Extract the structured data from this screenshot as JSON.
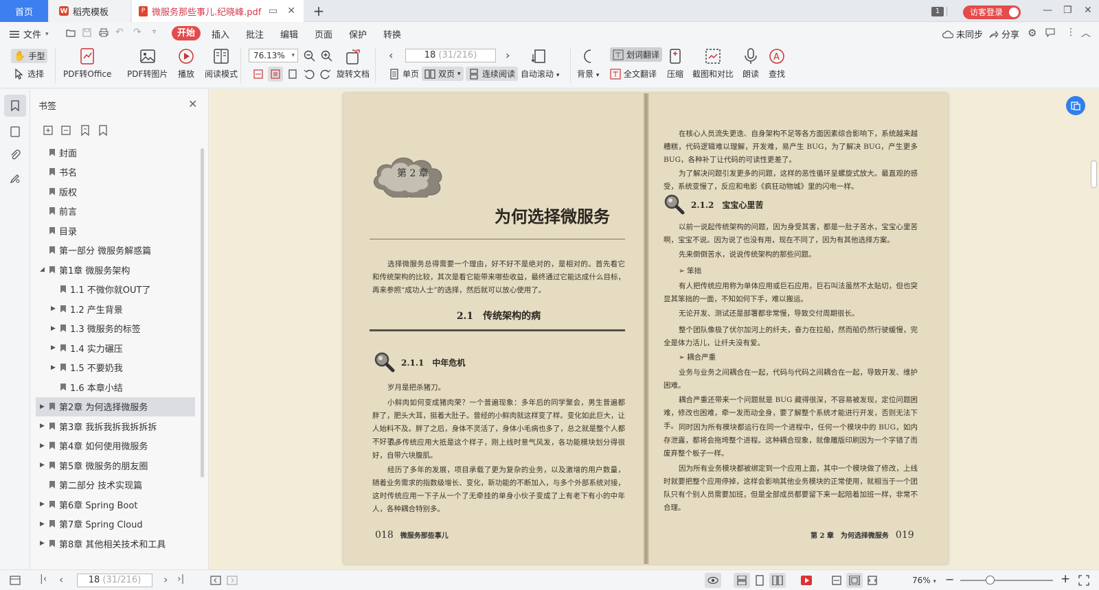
{
  "tabs": {
    "home": "首页",
    "templates": "稻壳模板",
    "document": "微服务那些事儿.纪晓峰.pdf",
    "add": "+"
  },
  "titlebar": {
    "badge": "1",
    "visitor_login": "访客登录",
    "minimize": "—",
    "maximize": "❐",
    "close": "✕"
  },
  "menu": {
    "file": "文件",
    "items": [
      "开始",
      "插入",
      "批注",
      "编辑",
      "页面",
      "保护",
      "转换"
    ],
    "unsynced": "未同步",
    "share": "分享"
  },
  "ribbon": {
    "hand": "手型",
    "select": "选择",
    "pdf_to_office": "PDF转Office",
    "pdf_to_image": "PDF转图片",
    "play": "播放",
    "read_mode": "阅读模式",
    "zoom_value": "76.13%",
    "rotate": "旋转文档",
    "page_current": "18",
    "page_total": "(31/216)",
    "single_page": "单页",
    "double_page": "双页",
    "continuous": "连续阅读",
    "auto_scroll": "自动滚动",
    "background": "背景",
    "word_translate": "划词翻译",
    "full_translate": "全文翻译",
    "compress": "压缩",
    "screenshot_compare": "截图和对比",
    "read_aloud": "朗读",
    "find": "查找"
  },
  "bookmarks": {
    "title": "书签",
    "items": [
      {
        "label": "封面",
        "level": 0,
        "arrow": ""
      },
      {
        "label": "书名",
        "level": 0,
        "arrow": ""
      },
      {
        "label": "版权",
        "level": 0,
        "arrow": ""
      },
      {
        "label": "前言",
        "level": 0,
        "arrow": ""
      },
      {
        "label": "目录",
        "level": 0,
        "arrow": ""
      },
      {
        "label": "第一部分 微服务解惑篇",
        "level": 0,
        "arrow": ""
      },
      {
        "label": "第1章 微服务架构",
        "level": 0,
        "arrow": "down"
      },
      {
        "label": "1.1 不微你就OUT了",
        "level": 1,
        "arrow": ""
      },
      {
        "label": "1.2 产生背景",
        "level": 1,
        "arrow": "right"
      },
      {
        "label": "1.3 微服务的标签",
        "level": 1,
        "arrow": "right"
      },
      {
        "label": "1.4 实力碾压",
        "level": 1,
        "arrow": "right"
      },
      {
        "label": "1.5 不要奶我",
        "level": 1,
        "arrow": "right"
      },
      {
        "label": "1.6 本章小结",
        "level": 1,
        "arrow": ""
      },
      {
        "label": "第2章 为何选择微服务",
        "level": 0,
        "arrow": "right",
        "selected": true
      },
      {
        "label": "第3章 我拆我拆我拆拆拆",
        "level": 0,
        "arrow": "right"
      },
      {
        "label": "第4章 如何使用微服务",
        "level": 0,
        "arrow": "right"
      },
      {
        "label": "第5章 微服务的朋友圈",
        "level": 0,
        "arrow": "right"
      },
      {
        "label": "第二部分 技术实现篇",
        "level": 0,
        "arrow": ""
      },
      {
        "label": "第6章 Spring Boot",
        "level": 0,
        "arrow": "right"
      },
      {
        "label": "第7章 Spring Cloud",
        "level": 0,
        "arrow": "right"
      },
      {
        "label": "第8章 其他相关技术和工具",
        "level": 0,
        "arrow": "right"
      }
    ]
  },
  "left_page": {
    "chapter_badge": "第 2 章",
    "chapter_title": "为何选择微服务",
    "intro": "选择微服务总得需要一个理由，好不好不是绝对的，是相对的。首先看它和传统架构的比较，其次是看它能带来哪些收益，最终通过它能达成什么目标，再来参照“成功人士”的选择，然后就可以放心使用了。",
    "section": "2.1　传统架构的病",
    "subsection": "2.1.1　中年危机",
    "paragraphs": [
      "岁月是把杀猪刀。",
      "小鲜肉如何变成猪肉荣？一个普遍现象：多年后的同学聚会，男生普遍都胖了，肥头大耳，挺着大肚子。曾经的小鲜肉就这样变了样。变化如此巨大，让人始料不及。胖了之后，身体不灵活了，身体小毛病也多了，总之就是整个人都不好了。",
      "很多传统应用大抵是这个样子，刚上线时意气风发，各功能模块划分得很好，自带六块腹肌。",
      "经历了多年的发展，项目承载了更为复杂的业务，以及激增的用户数量，随着业务需求的指数级增长、变化，新功能的不断加入，与多个外部系统对接，这时传统应用一下子从一个了无牵挂的单身小伙子变成了上有老下有小的中年人，各种耦合特别多。"
    ],
    "footer_num": "018",
    "footer_title": "微服务那些事儿"
  },
  "right_page": {
    "p1": "在核心人员流失更迭、自身架构不足等各方面因素综合影响下，系统越来越糟糕，代码逻辑难以理解，开发难，易产生 BUG，为了解决 BUG，产生更多 BUG，各种补丁让代码的可读性更差了。",
    "p2": "为了解决问题引发更多的问题，这样的恶性循环呈螺旋式放大。最直观的感受，系统变慢了，反应和电影《疯狂动物城》里的闪电一样。",
    "subsection": "2.1.2　宝宝心里苦",
    "p3": "以前一说起传统架构的问题，因为身受其害，都是一肚子苦水，宝宝心里苦啊，宝宝不说。因为说了也没有用，现在不同了，因为有其他选择方案。",
    "p4": "先来倒倒苦水，说说传统架构的那些问题。",
    "b1": "➢ 笨拙",
    "p5": "有人把传统应用称为单体应用或巨石应用，巨石叫法虽然不太贴切，但也突显其笨拙的一面，不知如何下手，难以搬运。",
    "p6": "无论开发、测试还是部署都非常慢，导致交付周期很长。",
    "p7": "整个团队像极了伏尔加河上的纤夫，奋力在拉船，然而船仍然行驶缓慢，完全是体力活儿，让纤夫没有爱。",
    "b2": "➢ 耦合严重",
    "p8": "业务与业务之间耦合在一起，代码与代码之间耦合在一起，导致开发、维护困难。",
    "p9": "耦合严重还带来一个问题就是 BUG 藏得很深，不容易被发现，定位问题困难，修改也困难，牵一发而动全身，要了解整个系统才能进行开发，否则无法下手。",
    "p10": "同时因为所有模块都运行在同一个进程中，任何一个模块中的 BUG，如内存泄露，都将会拖垮整个进程。这种耦合现象，就像雕版印刷因为一个字错了而废弃整个板子一样。",
    "p11": "因为所有业务模块都被绑定到一个应用上面，其中一个模块做了修改，上线时就要把整个应用停掉，这样会影响其他业务模块的正常使用，就相当于一个团队只有个别人员需要加班，但是全部成员都要留下来一起陪着加班一样，非常不合理。",
    "footer_chapter": "第 2 章　为何选择微服务",
    "footer_num": "019"
  },
  "statusbar": {
    "page_current": "18",
    "page_total": "(31/216)",
    "zoom": "76%",
    "zoom_level_pct": 32
  }
}
